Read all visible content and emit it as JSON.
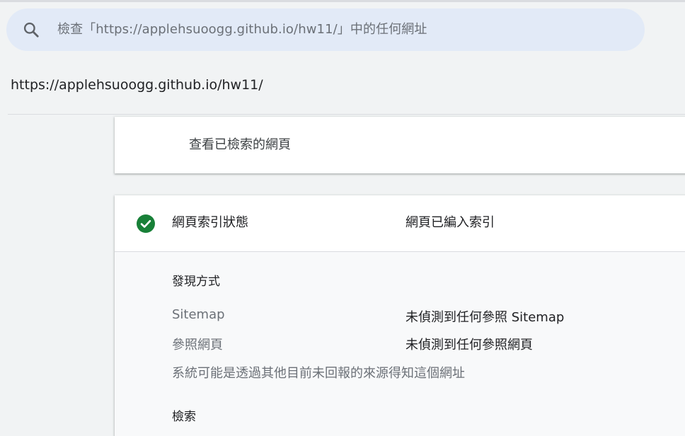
{
  "search": {
    "placeholder_text": "檢查「https://applehsuoogg.github.io/hw11/」中的任何網址",
    "icon": "search-icon"
  },
  "page": {
    "url": "https://applehsuoogg.github.io/hw11/"
  },
  "view_card": {
    "link_label": "查看已檢索的網頁"
  },
  "status_card": {
    "icon": "check-circle-icon",
    "status_color": "#188038",
    "label": "網頁索引狀態",
    "value": "網頁已編入索引",
    "discovery": {
      "heading": "發現方式",
      "rows": [
        {
          "label": "Sitemap",
          "value": "未偵測到任何參照 Sitemap"
        },
        {
          "label": "參照網頁",
          "value": "未偵測到任何參照網頁"
        }
      ],
      "note": "系統可能是透過其他目前未回報的來源得知這個網址"
    },
    "crawl": {
      "heading": "檢索"
    }
  }
}
